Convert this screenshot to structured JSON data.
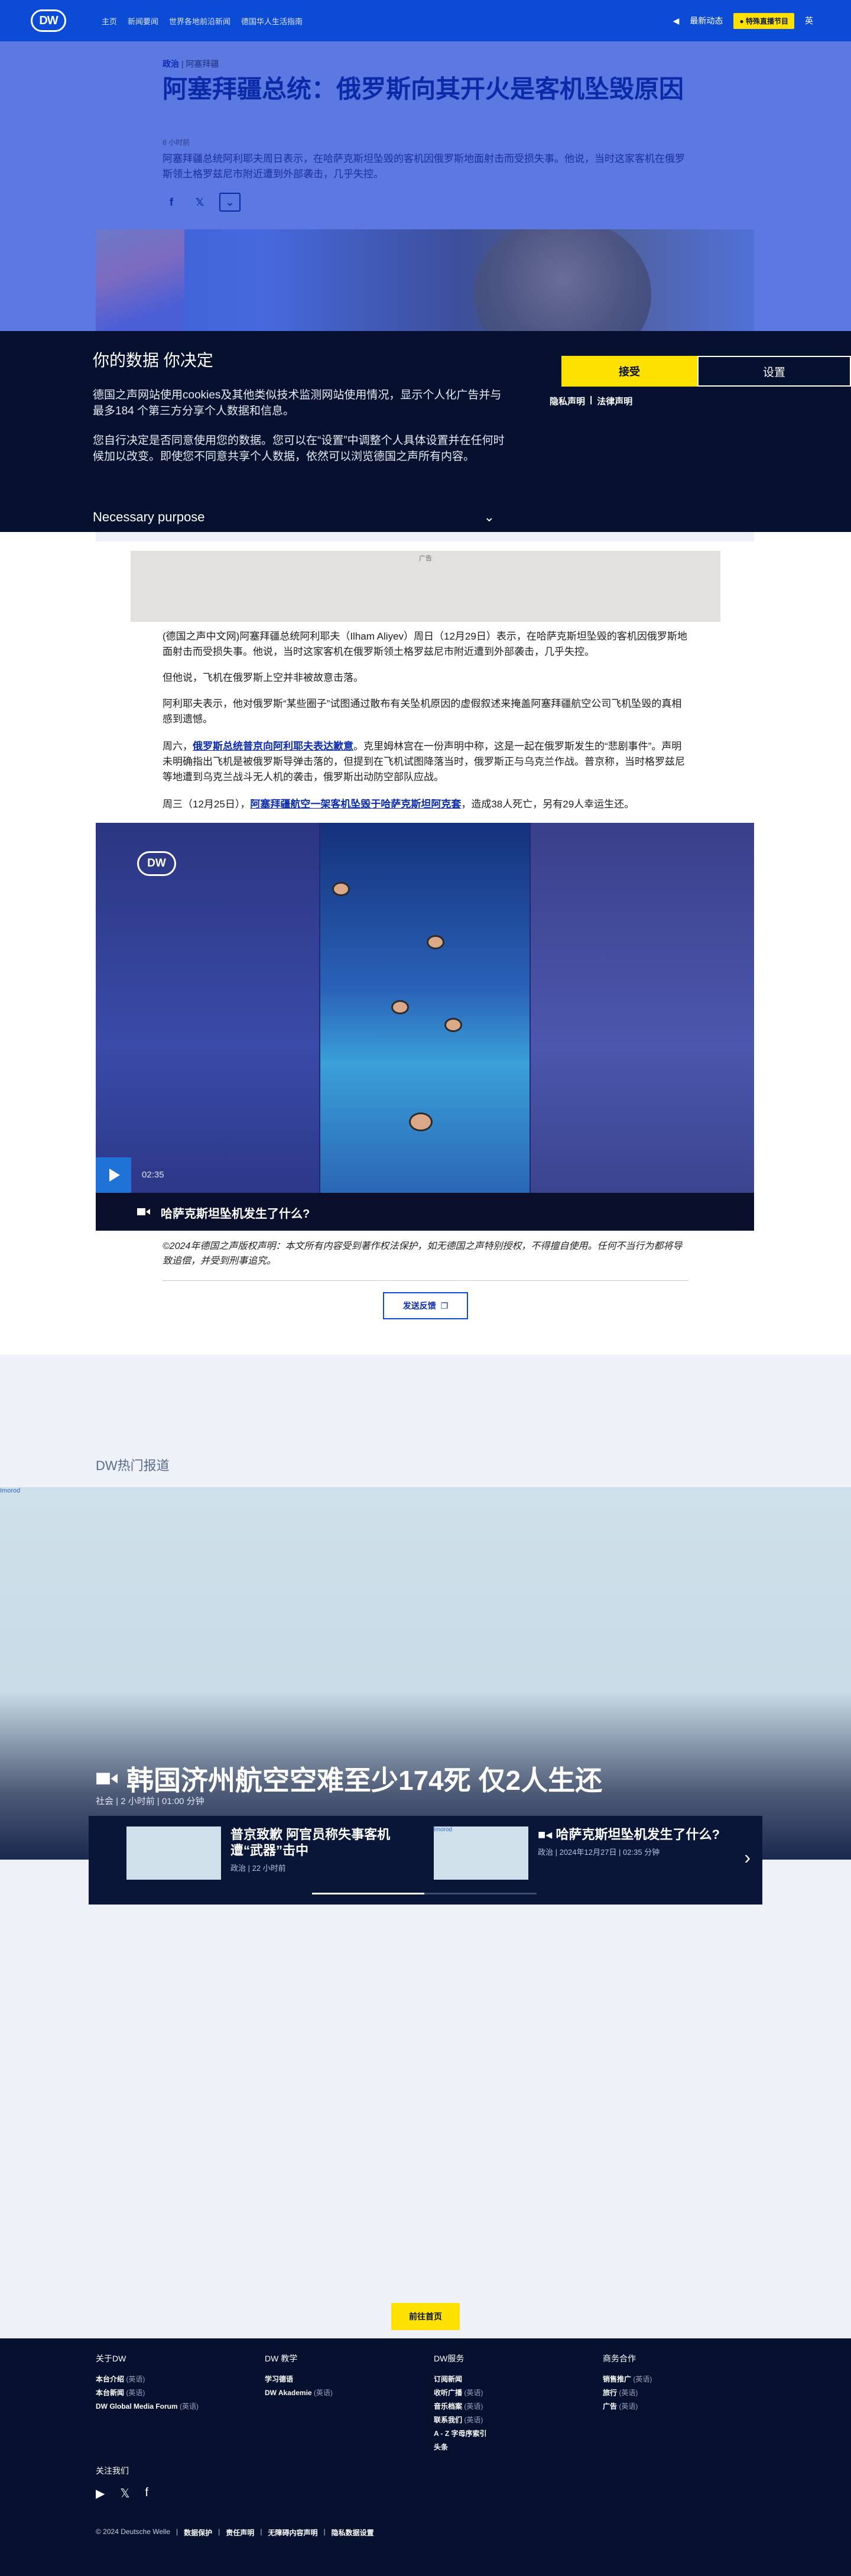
{
  "header": {
    "logo": "DW",
    "nav": [
      "主页",
      "新闻要闻",
      "世界各地前沿新闻",
      "德国华人生活指南"
    ],
    "live_label": "最新动态",
    "live_badge": "● 特殊直播节目",
    "lang": "英"
  },
  "article": {
    "section": "政治",
    "section_sub": "阿塞拜疆",
    "title": "阿塞拜疆总统：俄罗斯向其开火是客机坠毁原因",
    "time": "8 小时前",
    "lead": "阿塞拜疆总统阿利耶夫周日表示，在哈萨克斯坦坠毁的客机因俄罗斯地面射击而受损失事。他说，当时这家客机在俄罗斯领土格罗兹尼市附近遭到外部袭击，几乎失控。",
    "ad_label": "广告",
    "paragraphs": [
      "(德国之声中文网)阿塞拜疆总统阿利耶夫（Ilham Aliyev）周日（12月29日）表示，在哈萨克斯坦坠毁的客机因俄罗斯地面射击而受损失事。他说，当时这家客机在俄罗斯领土格罗兹尼市附近遭到外部袭击，几乎失控。",
      "但他说，飞机在俄罗斯上空并非被故意击落。",
      "阿利耶夫表示，他对俄罗斯“某些圈子”试图通过散布有关坠机原因的虚假叙述来掩盖阿塞拜疆航空公司飞机坠毁的真相感到遗憾。"
    ],
    "para4_pre": "周六，",
    "para4_link": "俄罗斯总统普京向阿利耶夫表达歉意",
    "para4_post": "。克里姆林宫在一份声明中称，这是一起在俄罗斯发生的“悲剧事件”。声明未明确指出飞机是被俄罗斯导弹击落的，但提到在飞机试图降落当时，俄罗斯正与乌克兰作战。普京称，当时格罗兹尼等地遭到乌克兰战斗无人机的袭击，俄罗斯出动防空部队应战。",
    "para5_pre": "周三（12月25日），",
    "para5_link": "阿塞拜疆航空一架客机坠毁于哈萨克斯坦阿克套",
    "para5_post": "，造成38人死亡，另有29人幸运生还。",
    "video": {
      "logo": "DW",
      "duration": "02:35",
      "caption": "哈萨克斯坦坠机发生了什么?"
    },
    "copyright": "©2024年德国之声版权声明：本文所有内容受到著作权法保护，如无德国之声特别授权，不得擅自使用。任何不当行为都将导致追偿，并受到刑事追究。",
    "feedback": "发送反馈"
  },
  "cookie": {
    "title": "你的数据 你决定",
    "p1": "德国之声网站使用cookies及其他类似技术监测网站使用情况，显示个人化广告并与最多184 个第三方分享个人数据和信息。",
    "p2": "您自行决定是否同意使用您的数据。您可以在“设置”中调整个人具体设置并在任何时候加以改变。即使您不同意共享个人数据，依然可以浏览德国之声所有内容。",
    "purpose": "Necessary purpose",
    "accept": "接受",
    "settings": "设置",
    "privacy": "隐私声明",
    "legal": "法律声明"
  },
  "trending": {
    "title": "DW热门报道",
    "image_alt": "Imorod",
    "top_title": "韩国济州航空空难至少174死 仅2人生还",
    "top_meta": "社会 | 2 小时前 | 01:00 分钟",
    "cards": [
      {
        "title": "普京致歉 阿官员称失事客机遭“武器”击中",
        "meta": "政治 | 22 小时前",
        "thumb_alt": ""
      },
      {
        "title": "哈萨克斯坦坠机发生了什么?",
        "meta": "政治 | 2024年12月27日 | 02:35 分钟",
        "thumb_alt": "Imorod"
      }
    ],
    "next": "›"
  },
  "home_button": "前往首页",
  "footer": {
    "columns": [
      {
        "title": "关于DW",
        "items": [
          {
            "t": "本台介绍",
            "s": "(英语)"
          },
          {
            "t": "本台新闻",
            "s": "(英语)"
          },
          {
            "t": "DW Global Media Forum",
            "s": "(英语)"
          }
        ]
      },
      {
        "title": "DW 教学",
        "items": [
          {
            "t": "学习德语",
            "s": ""
          },
          {
            "t": "DW Akademie",
            "s": "(英语)"
          }
        ]
      },
      {
        "title": "DW服务",
        "items": [
          {
            "t": "订阅新闻",
            "s": ""
          },
          {
            "t": "收听广播",
            "s": "(英语)"
          },
          {
            "t": "音乐档案",
            "s": "(英语)"
          },
          {
            "t": "联系我们",
            "s": "(英语)"
          },
          {
            "t": "A - Z 字母序索引",
            "s": ""
          },
          {
            "t": "头条",
            "s": ""
          }
        ]
      },
      {
        "title": "商务合作",
        "items": [
          {
            "t": "销售推广",
            "s": "(英语)"
          },
          {
            "t": "旅行",
            "s": "(英语)"
          },
          {
            "t": "广告",
            "s": "(英语)"
          }
        ]
      }
    ],
    "follow": "关注我们",
    "legal_copy": "© 2024 Deutsche Welle",
    "legal_links": [
      "数据保护",
      "责任声明",
      "无障碍内容声明",
      "隐私数据设置"
    ]
  }
}
